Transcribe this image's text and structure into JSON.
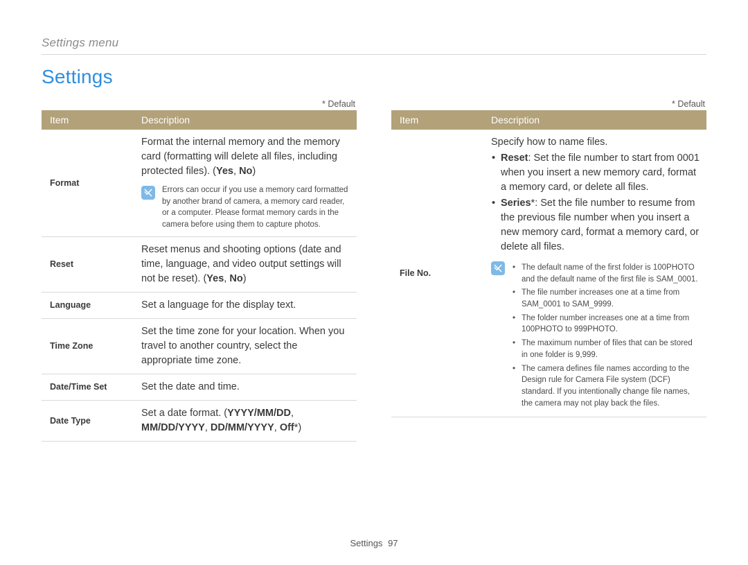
{
  "breadcrumb": "Settings menu",
  "title": "Settings",
  "default_note": "* Default",
  "columns": {
    "left": {
      "header_item": "Item",
      "header_desc": "Description",
      "rows": {
        "format": {
          "item": "Format",
          "desc_pre": "Format the internal memory and the memory card (formatting will delete all files, including protected files). (",
          "opt_yes": "Yes",
          "sep": ", ",
          "opt_no": "No",
          "desc_post": ")",
          "note": "Errors can occur if you use a memory card formatted by another brand of camera, a memory card reader, or a computer. Please format memory cards in the camera before using them to capture photos."
        },
        "reset": {
          "item": "Reset",
          "desc_pre": "Reset menus and shooting options (date and time, language, and video output settings will not be reset). (",
          "opt_yes": "Yes",
          "sep": ", ",
          "opt_no": "No",
          "desc_post": ")"
        },
        "language": {
          "item": "Language",
          "desc": "Set a language for the display text."
        },
        "timezone": {
          "item": "Time Zone",
          "desc": "Set the time zone for your location. When you travel to another country, select the appropriate time zone."
        },
        "datetime": {
          "item": "Date/Time Set",
          "desc": "Set the date and time."
        },
        "datetype": {
          "item": "Date Type",
          "desc_pre": "Set a date format. (",
          "opt1": "YYYY/MM/DD",
          "sep1": ", ",
          "opt2": "MM/DD/YYYY",
          "sep2": ", ",
          "opt3": "DD/MM/YYYY",
          "sep3": ", ",
          "opt4": "Off",
          "star": "*",
          "desc_post": ")"
        }
      }
    },
    "right": {
      "header_item": "Item",
      "header_desc": "Description",
      "rows": {
        "fileno": {
          "item": "File No.",
          "intro": "Specify how to name files.",
          "bullet_reset_label": "Reset",
          "bullet_reset_text": ": Set the file number to start from 0001 when you insert a new memory card, format a memory card, or delete all files.",
          "bullet_series_label": "Series",
          "bullet_series_star": "*",
          "bullet_series_text": ": Set the file number to resume from the previous file number when you insert a new memory card, format a memory card, or delete all files.",
          "notes": {
            "n1": "The default name of the first folder is 100PHOTO and the default name of the first file is SAM_0001.",
            "n2": "The file number increases one at a time from SAM_0001 to SAM_9999.",
            "n3": "The folder number increases one at a time from 100PHOTO to 999PHOTO.",
            "n4": "The maximum number of files that can be stored in one folder is 9,999.",
            "n5": "The camera defines file names according to the Design rule for Camera File system (DCF) standard. If you intentionally change file names, the camera may not play back the files."
          }
        }
      }
    }
  },
  "footer": {
    "label": "Settings",
    "page": "97"
  }
}
